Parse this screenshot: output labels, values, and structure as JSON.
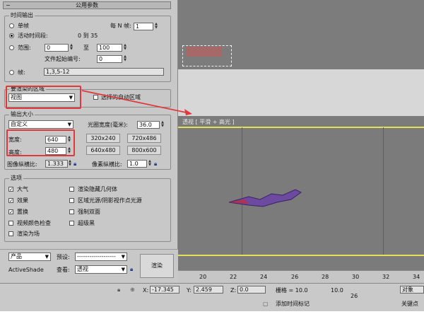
{
  "panel": {
    "title": "公用参数",
    "time_output": {
      "group_title": "时间输出",
      "single": "单帧",
      "every_n_label": "每 N 帧:",
      "every_n_value": "1",
      "active_segment": "活动时间段:",
      "active_range": "0 到 35",
      "range_label": "范围:",
      "range_from": "0",
      "range_to_label": "至",
      "range_to": "100",
      "file_start_label": "文件起始编号:",
      "file_start": "0",
      "frames_label": "帧:",
      "frames_value": "1,3,5-12"
    },
    "render_area": {
      "group_title": "要渲染的区域",
      "selected": "视图",
      "auto_region_label": "选择的自动区域"
    },
    "output_size": {
      "group_title": "输出大小",
      "preset": "自定义",
      "aperture_label": "光圈宽度(毫米):",
      "aperture_value": "36.0",
      "width_label": "宽度:",
      "width_value": "640",
      "height_label": "高度:",
      "height_value": "480",
      "presets": [
        "320x240",
        "720x486",
        "640x480",
        "800x600"
      ],
      "image_aspect_label": "图像纵横比:",
      "image_aspect_value": "1.333",
      "pixel_aspect_label": "像素纵横比:",
      "pixel_aspect_value": "1.0"
    },
    "options": {
      "group_title": "选项",
      "left": [
        {
          "label": "大气",
          "checked": true
        },
        {
          "label": "效果",
          "checked": true
        },
        {
          "label": "置换",
          "checked": true
        },
        {
          "label": "视频颜色检查",
          "checked": false
        },
        {
          "label": "渲染为场",
          "checked": false
        }
      ],
      "right": [
        {
          "label": "渲染隐藏几何体",
          "checked": false
        },
        {
          "label": "区域光源/阴影视作点光源",
          "checked": false
        },
        {
          "label": "强制双面",
          "checked": false
        },
        {
          "label": "超级黑",
          "checked": false
        }
      ]
    },
    "bottom": {
      "mode": "产品",
      "preset_label": "预设:",
      "preset_value": "-------------------",
      "activeshade": "ActiveShade",
      "view_label": "查看:",
      "view_value": "透视",
      "render_button": "渲染"
    }
  },
  "viewport": {
    "label": "透视 [ 平滑 + 高光 ]"
  },
  "timeline": {
    "ticks": [
      "20",
      "22",
      "24",
      "26",
      "28",
      "30",
      "32",
      "34"
    ]
  },
  "status": {
    "x_label": "X:",
    "x_value": "-17.345",
    "y_label": "Y:",
    "y_value": "2.459",
    "z_label": "Z:",
    "z_value": "0.0",
    "grid_label": "栅格 = 10.0",
    "grid_value": "10.0",
    "frame_value": "26",
    "object_label": "对象",
    "add_marker": "添加时间标记",
    "keypoint": "关键点"
  },
  "colors": {
    "panel": "#c8c8c8",
    "viewport": "#7b7b7b",
    "highlight": "#e0393c",
    "timeline_line": "#e5e05a"
  }
}
